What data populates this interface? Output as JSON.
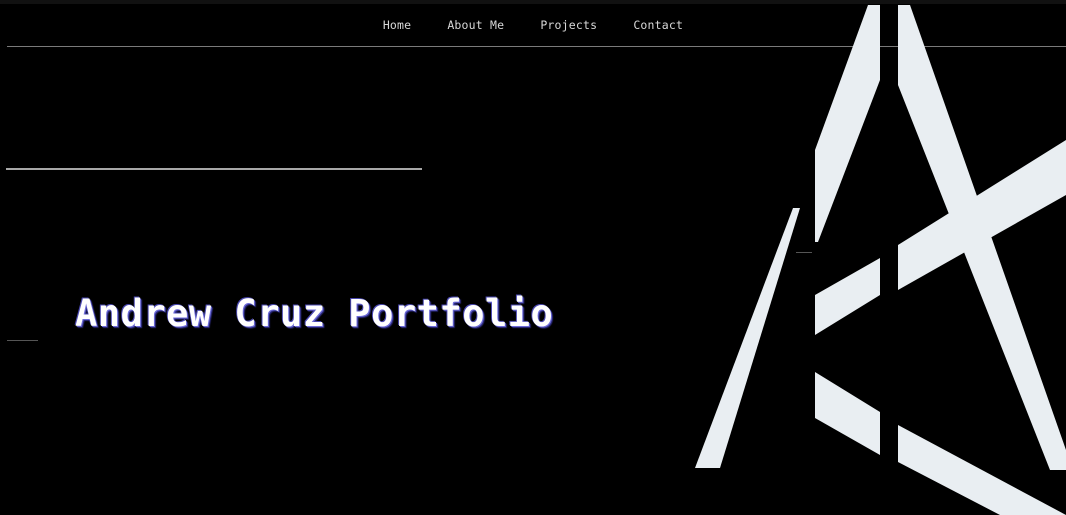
{
  "nav": {
    "items": [
      {
        "label": "Home"
      },
      {
        "label": "About Me"
      },
      {
        "label": "Projects"
      },
      {
        "label": "Contact"
      }
    ]
  },
  "hero": {
    "title": "Andrew Cruz Portfolio"
  },
  "logo": {
    "icon": "ac-monogram-logo",
    "color": "#e9eef2"
  },
  "colors": {
    "background": "#000000",
    "text": "#ffffff",
    "title_shadow": "#6d6bd8"
  }
}
